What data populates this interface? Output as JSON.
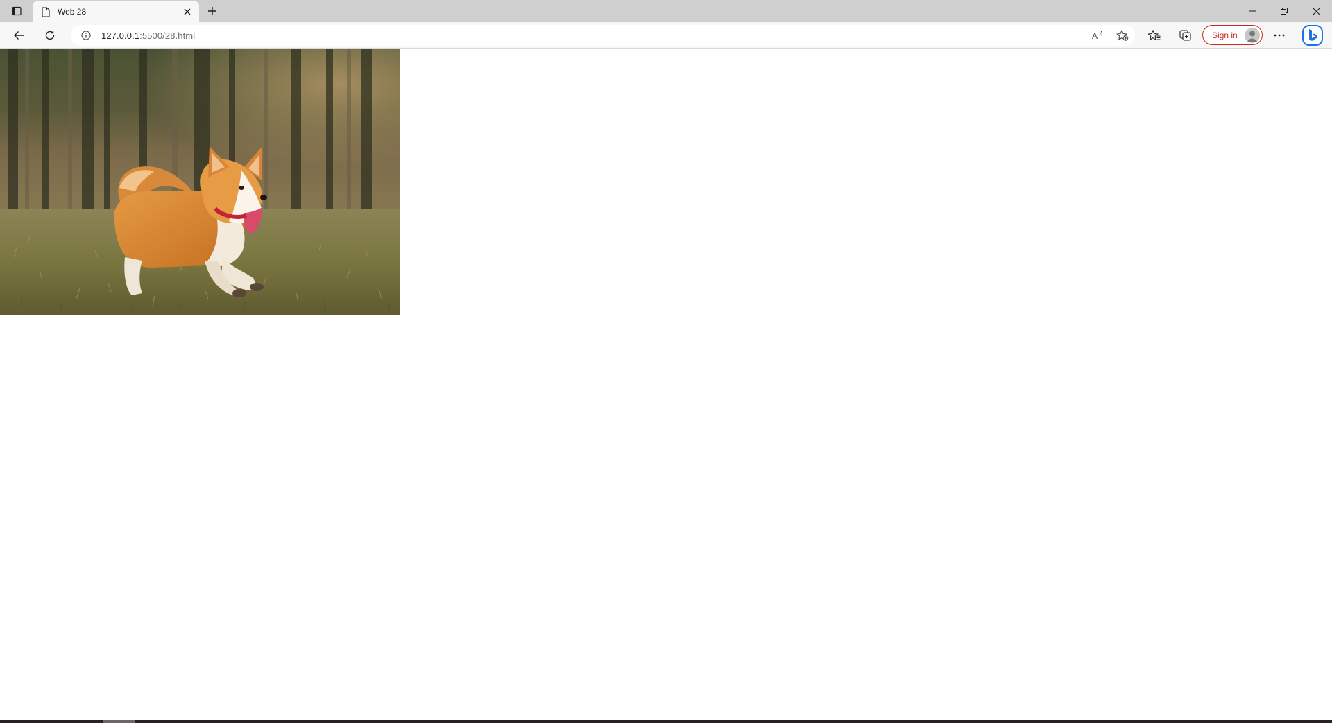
{
  "browser": {
    "tab": {
      "title": "Web 28"
    },
    "address": {
      "host": "127.0.0.1",
      "path": ":5500/28.html"
    },
    "signin_label": "Sign in"
  },
  "page": {
    "image": {
      "subject": "corgi running on grass",
      "icon": "photo"
    }
  },
  "colors": {
    "tabstrip": "#cfcfcf",
    "toolbar": "#f7f7f7",
    "signin_accent": "#c42b1c",
    "bing_blue": "#1a73e8"
  }
}
